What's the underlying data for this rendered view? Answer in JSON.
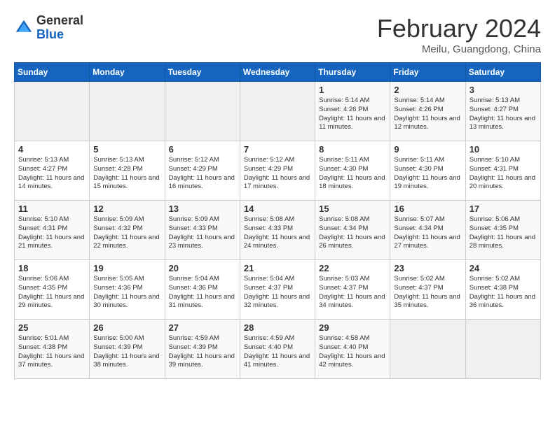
{
  "header": {
    "logo_general": "General",
    "logo_blue": "Blue",
    "title": "February 2024",
    "location": "Meilu, Guangdong, China"
  },
  "days_of_week": [
    "Sunday",
    "Monday",
    "Tuesday",
    "Wednesday",
    "Thursday",
    "Friday",
    "Saturday"
  ],
  "weeks": [
    [
      {
        "day": "",
        "info": ""
      },
      {
        "day": "",
        "info": ""
      },
      {
        "day": "",
        "info": ""
      },
      {
        "day": "",
        "info": ""
      },
      {
        "day": "1",
        "info": "Sunrise: 5:14 AM\nSunset: 4:26 PM\nDaylight: 11 hours\nand 11 minutes."
      },
      {
        "day": "2",
        "info": "Sunrise: 5:14 AM\nSunset: 4:26 PM\nDaylight: 11 hours\nand 12 minutes."
      },
      {
        "day": "3",
        "info": "Sunrise: 5:13 AM\nSunset: 4:27 PM\nDaylight: 11 hours\nand 13 minutes."
      }
    ],
    [
      {
        "day": "4",
        "info": "Sunrise: 5:13 AM\nSunset: 4:27 PM\nDaylight: 11 hours\nand 14 minutes."
      },
      {
        "day": "5",
        "info": "Sunrise: 5:13 AM\nSunset: 4:28 PM\nDaylight: 11 hours\nand 15 minutes."
      },
      {
        "day": "6",
        "info": "Sunrise: 5:12 AM\nSunset: 4:29 PM\nDaylight: 11 hours\nand 16 minutes."
      },
      {
        "day": "7",
        "info": "Sunrise: 5:12 AM\nSunset: 4:29 PM\nDaylight: 11 hours\nand 17 minutes."
      },
      {
        "day": "8",
        "info": "Sunrise: 5:11 AM\nSunset: 4:30 PM\nDaylight: 11 hours\nand 18 minutes."
      },
      {
        "day": "9",
        "info": "Sunrise: 5:11 AM\nSunset: 4:30 PM\nDaylight: 11 hours\nand 19 minutes."
      },
      {
        "day": "10",
        "info": "Sunrise: 5:10 AM\nSunset: 4:31 PM\nDaylight: 11 hours\nand 20 minutes."
      }
    ],
    [
      {
        "day": "11",
        "info": "Sunrise: 5:10 AM\nSunset: 4:31 PM\nDaylight: 11 hours\nand 21 minutes."
      },
      {
        "day": "12",
        "info": "Sunrise: 5:09 AM\nSunset: 4:32 PM\nDaylight: 11 hours\nand 22 minutes."
      },
      {
        "day": "13",
        "info": "Sunrise: 5:09 AM\nSunset: 4:33 PM\nDaylight: 11 hours\nand 23 minutes."
      },
      {
        "day": "14",
        "info": "Sunrise: 5:08 AM\nSunset: 4:33 PM\nDaylight: 11 hours\nand 24 minutes."
      },
      {
        "day": "15",
        "info": "Sunrise: 5:08 AM\nSunset: 4:34 PM\nDaylight: 11 hours\nand 26 minutes."
      },
      {
        "day": "16",
        "info": "Sunrise: 5:07 AM\nSunset: 4:34 PM\nDaylight: 11 hours\nand 27 minutes."
      },
      {
        "day": "17",
        "info": "Sunrise: 5:06 AM\nSunset: 4:35 PM\nDaylight: 11 hours\nand 28 minutes."
      }
    ],
    [
      {
        "day": "18",
        "info": "Sunrise: 5:06 AM\nSunset: 4:35 PM\nDaylight: 11 hours\nand 29 minutes."
      },
      {
        "day": "19",
        "info": "Sunrise: 5:05 AM\nSunset: 4:36 PM\nDaylight: 11 hours\nand 30 minutes."
      },
      {
        "day": "20",
        "info": "Sunrise: 5:04 AM\nSunset: 4:36 PM\nDaylight: 11 hours\nand 31 minutes."
      },
      {
        "day": "21",
        "info": "Sunrise: 5:04 AM\nSunset: 4:37 PM\nDaylight: 11 hours\nand 32 minutes."
      },
      {
        "day": "22",
        "info": "Sunrise: 5:03 AM\nSunset: 4:37 PM\nDaylight: 11 hours\nand 34 minutes."
      },
      {
        "day": "23",
        "info": "Sunrise: 5:02 AM\nSunset: 4:37 PM\nDaylight: 11 hours\nand 35 minutes."
      },
      {
        "day": "24",
        "info": "Sunrise: 5:02 AM\nSunset: 4:38 PM\nDaylight: 11 hours\nand 36 minutes."
      }
    ],
    [
      {
        "day": "25",
        "info": "Sunrise: 5:01 AM\nSunset: 4:38 PM\nDaylight: 11 hours\nand 37 minutes."
      },
      {
        "day": "26",
        "info": "Sunrise: 5:00 AM\nSunset: 4:39 PM\nDaylight: 11 hours\nand 38 minutes."
      },
      {
        "day": "27",
        "info": "Sunrise: 4:59 AM\nSunset: 4:39 PM\nDaylight: 11 hours\nand 39 minutes."
      },
      {
        "day": "28",
        "info": "Sunrise: 4:59 AM\nSunset: 4:40 PM\nDaylight: 11 hours\nand 41 minutes."
      },
      {
        "day": "29",
        "info": "Sunrise: 4:58 AM\nSunset: 4:40 PM\nDaylight: 11 hours\nand 42 minutes."
      },
      {
        "day": "",
        "info": ""
      },
      {
        "day": "",
        "info": ""
      }
    ]
  ]
}
